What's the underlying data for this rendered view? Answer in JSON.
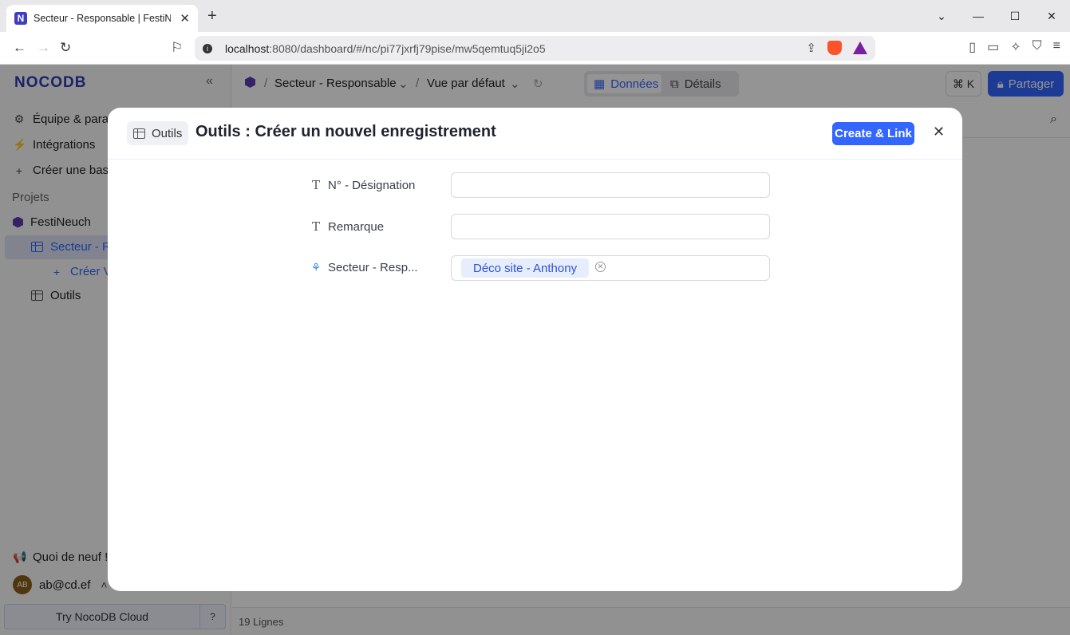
{
  "browser": {
    "tab_title": "Secteur - Responsable | FestiNeuch",
    "url_host": "localhost",
    "url_rest": ":8080/dashboard/#/nc/pi77jxrfj79pise/mw5qemtuq5ji2o5"
  },
  "sidebar": {
    "logo": "NOCODB",
    "team_settings": "Équipe & paramètres",
    "integrations": "Intégrations",
    "create_base": "Créer une base",
    "projects_label": "Projets",
    "project_name": "FestiNeuch",
    "table_active": "Secteur - Responsable",
    "create_view": "Créer Vue",
    "table_other": "Outils",
    "whats_new": "Quoi de neuf !",
    "user_initials": "AB",
    "user_email": "ab@cd.ef",
    "try_cloud": "Try NocoDB Cloud"
  },
  "topbar": {
    "crumb_table": "Secteur - Responsable",
    "crumb_view": "Vue par défaut",
    "tab_data": "Données",
    "tab_details": "Détails",
    "cmdk": "⌘ K",
    "share": "Partager"
  },
  "footer": {
    "rows": "19 Lignes"
  },
  "modal": {
    "table_chip": "Outils",
    "title": "Outils : Créer un nouvel enregistrement",
    "create_link": "Create & Link",
    "fields": [
      {
        "label": "N° - Désignation",
        "value": ""
      },
      {
        "label": "Remarque",
        "value": ""
      },
      {
        "label": "Secteur - Resp...",
        "value": "Déco site - Anthony"
      }
    ]
  },
  "colors": {
    "accent": "#3366ff",
    "logo": "#2b3bb5",
    "overlay": "rgba(0,0,0,0.42)"
  }
}
